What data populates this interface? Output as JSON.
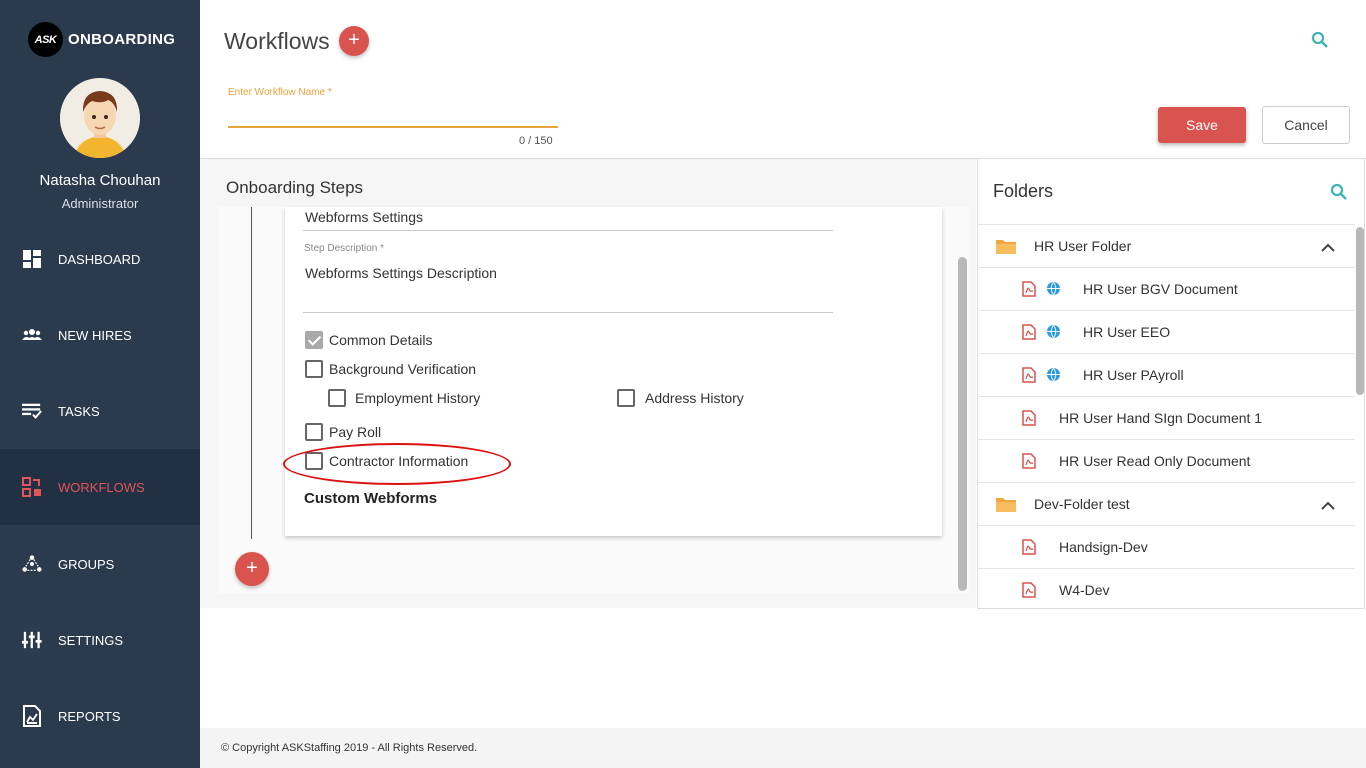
{
  "brand": {
    "logo": "ASK",
    "name": "ONBOARDING"
  },
  "user": {
    "name": "Natasha Chouhan",
    "role": "Administrator"
  },
  "nav": [
    {
      "label": "DASHBOARD",
      "icon": "dashboard-icon"
    },
    {
      "label": "NEW HIRES",
      "icon": "people-icon"
    },
    {
      "label": "TASKS",
      "icon": "tasks-icon"
    },
    {
      "label": "WORKFLOWS",
      "icon": "workflow-icon",
      "active": true
    },
    {
      "label": "GROUPS",
      "icon": "groups-icon"
    },
    {
      "label": "SETTINGS",
      "icon": "sliders-icon"
    },
    {
      "label": "REPORTS",
      "icon": "report-icon"
    }
  ],
  "header": {
    "title": "Workflows",
    "add": "+",
    "workflow_name_label": "Enter Workflow Name *",
    "workflow_name_value": "",
    "char_count": "0 / 150",
    "save_label": "Save",
    "cancel_label": "Cancel"
  },
  "steps": {
    "title": "Onboarding Steps",
    "step_name": "Webforms Settings",
    "description_label": "Step Description *",
    "description_value": "Webforms Settings Description",
    "options": {
      "common_details": "Common Details",
      "background_verification": "Background Verification",
      "employment_history": "Employment History",
      "address_history": "Address History",
      "pay_roll": "Pay Roll",
      "contractor_information": "Contractor Information"
    },
    "custom_webforms": "Custom Webforms",
    "add_step": "+"
  },
  "folders": {
    "title": "Folders",
    "items": [
      {
        "type": "folder",
        "label": "HR User Folder"
      },
      {
        "type": "doc",
        "label": "HR User BGV Document",
        "web": true
      },
      {
        "type": "doc",
        "label": "HR User EEO",
        "web": true
      },
      {
        "type": "doc",
        "label": "HR User PAyroll",
        "web": true
      },
      {
        "type": "doc",
        "label": "HR User Hand SIgn Document 1",
        "web": false
      },
      {
        "type": "doc",
        "label": "HR User Read Only Document",
        "web": false
      },
      {
        "type": "folder",
        "label": "Dev-Folder test"
      },
      {
        "type": "doc",
        "label": "Handsign-Dev",
        "web": false
      },
      {
        "type": "doc",
        "label": "W4-Dev",
        "web": false
      }
    ]
  },
  "footer": {
    "copyright": "© Copyright ASKStaffing 2019 - All Rights Reserved."
  },
  "colors": {
    "sidebar": "#2c3a4e",
    "accent": "#d9534f",
    "input_focus": "#e8a33a",
    "teal": "#3fb5b0"
  }
}
